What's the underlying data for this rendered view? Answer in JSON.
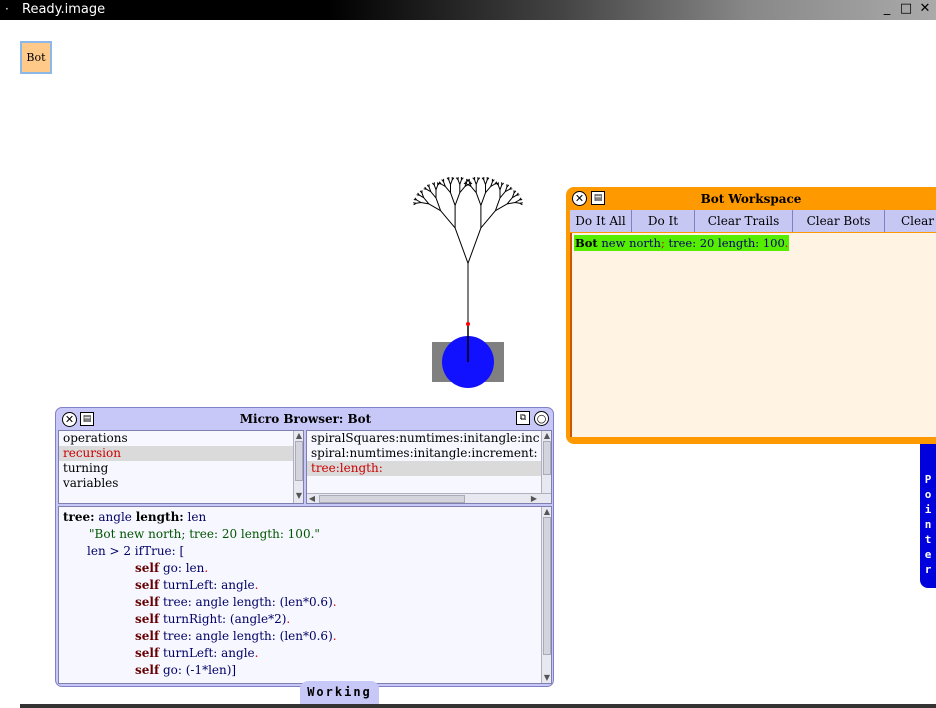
{
  "window": {
    "title": "Ready.image",
    "menu_glyph": "·",
    "minimize": "_",
    "maximize": "□",
    "close": "✕"
  },
  "bot_button": {
    "label": "Bot"
  },
  "workspace": {
    "title": "Bot Workspace",
    "buttons": [
      "Do It All",
      "Do It",
      "Clear Trails",
      "Clear Bots",
      "Clear"
    ],
    "code": {
      "kw": "Bot",
      "rest1": "new north",
      "semi": ";",
      "rest2": "tree: 20 length: 100",
      "dot": "."
    }
  },
  "pointer_flap": {
    "letters": [
      "P",
      "o",
      "i",
      "n",
      "t",
      "e",
      "r"
    ]
  },
  "browser": {
    "title": "Micro Browser: Bot",
    "categories": [
      {
        "label": "operations",
        "selected": false
      },
      {
        "label": "recursion",
        "selected": true
      },
      {
        "label": "turning",
        "selected": false
      },
      {
        "label": "variables",
        "selected": false
      }
    ],
    "methods": [
      {
        "label": "spiralSquares:numtimes:initangle:inc",
        "selected": false
      },
      {
        "label": "spiral:numtimes:initangle:increment:",
        "selected": false
      },
      {
        "label": "tree:length:",
        "selected": true
      }
    ],
    "code": {
      "l1a": "tree:",
      "l1b": " angle ",
      "l1c": "length:",
      "l1d": " len",
      "l2": "\"Bot new north; tree: 20 length: 100.\"",
      "l3": "len > 2 ifTrue: [",
      "self": "self",
      "l4": " go: len",
      "l5": " turnLeft: angle",
      "l6": " tree: angle length: (len*0.6)",
      "l7": " turnRight: (angle*2)",
      "l8": " tree: angle length: (len*0.6)",
      "l9": " turnLeft: angle",
      "l10": " go: (-1*len)]",
      "dot": "."
    }
  },
  "status": {
    "label": "Working"
  },
  "colors": {
    "bot": "#1111ff",
    "workspace": "#ff9900",
    "browser": "#c8c8f8",
    "highlight": "#55ee00"
  }
}
